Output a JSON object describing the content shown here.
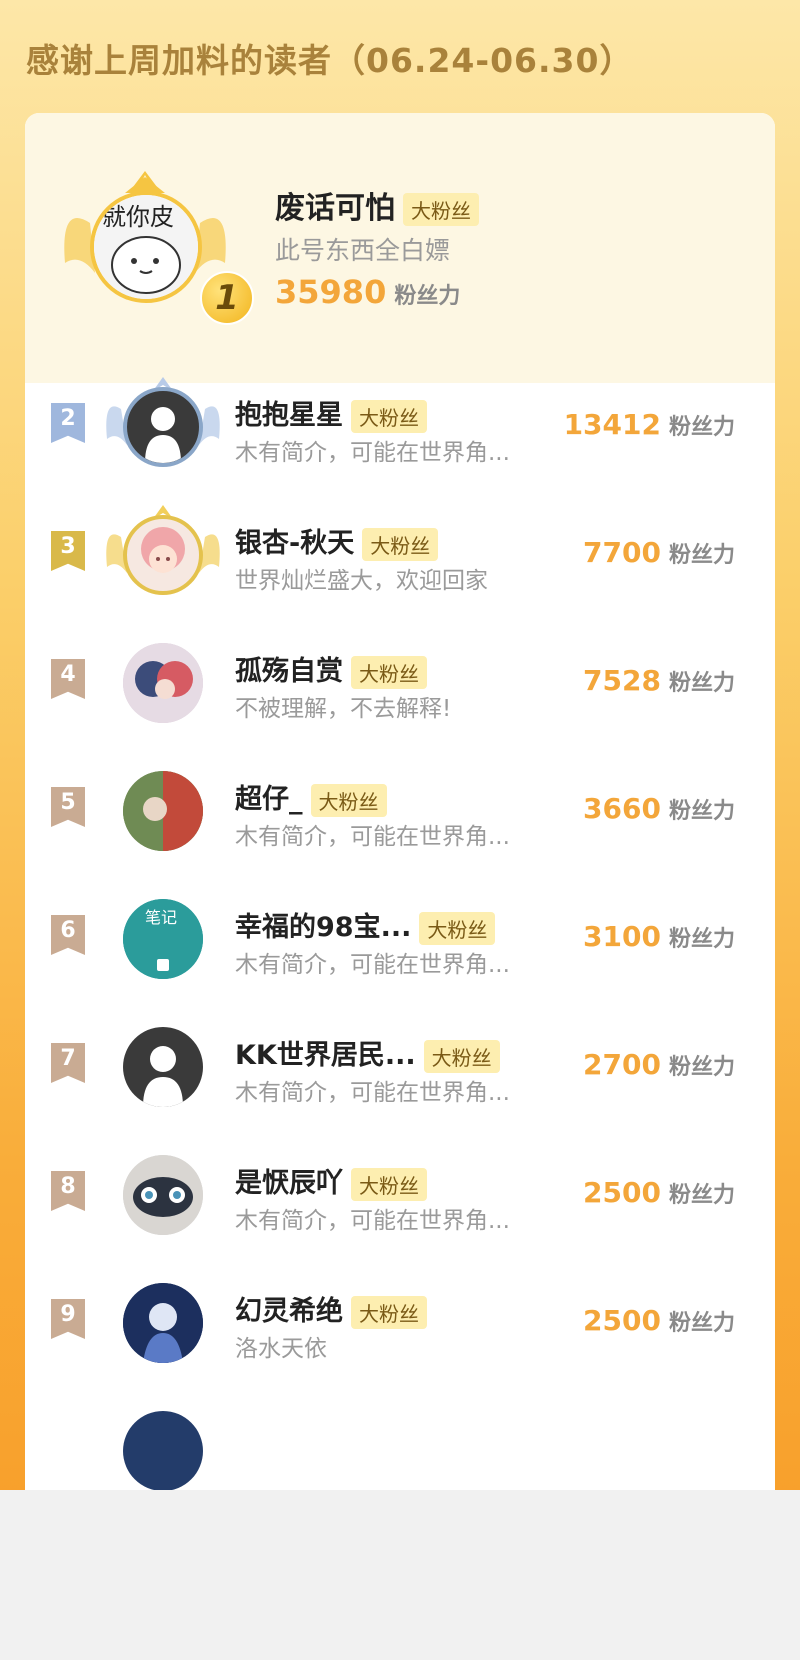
{
  "header": {
    "title": "感谢上周加料的读者（06.24-06.30）"
  },
  "top1": {
    "rank": "1",
    "name": "废话可怕",
    "tag": "大粉丝",
    "bio": "此号东西全白嫖",
    "power": "35980",
    "unit": "粉丝力",
    "avatar_text": "就你皮"
  },
  "rows": [
    {
      "rank": "2",
      "name": "抱抱星星",
      "tag": "大粉丝",
      "bio": "木有简介，可能在世界角...",
      "power": "13412",
      "unit": "粉丝力",
      "flag_color": "#9fb7dd"
    },
    {
      "rank": "3",
      "name": "银杏-秋天",
      "tag": "大粉丝",
      "bio": "世界灿烂盛大，欢迎回家",
      "power": "7700",
      "unit": "粉丝力",
      "flag_color": "#d9b94a"
    },
    {
      "rank": "4",
      "name": "孤殇自赏",
      "tag": "大粉丝",
      "bio": "不被理解，不去解释!",
      "power": "7528",
      "unit": "粉丝力",
      "flag_color": "#c9ab93"
    },
    {
      "rank": "5",
      "name": "超仔_",
      "tag": "大粉丝",
      "bio": "木有简介，可能在世界角...",
      "power": "3660",
      "unit": "粉丝力",
      "flag_color": "#c9ab93"
    },
    {
      "rank": "6",
      "name": "幸福的98宝...",
      "tag": "大粉丝",
      "bio": "木有简介，可能在世界角...",
      "power": "3100",
      "unit": "粉丝力",
      "flag_color": "#c9ab93",
      "avatar_text": "笔记"
    },
    {
      "rank": "7",
      "name": "KK世界居民...",
      "tag": "大粉丝",
      "bio": "木有简介，可能在世界角...",
      "power": "2700",
      "unit": "粉丝力",
      "flag_color": "#c9ab93"
    },
    {
      "rank": "8",
      "name": "是恹辰吖",
      "tag": "大粉丝",
      "bio": "木有简介，可能在世界角...",
      "power": "2500",
      "unit": "粉丝力",
      "flag_color": "#c9ab93"
    },
    {
      "rank": "9",
      "name": "幻灵希绝",
      "tag": "大粉丝",
      "bio": "洛水天依",
      "power": "2500",
      "unit": "粉丝力",
      "flag_color": "#c9ab93"
    }
  ],
  "colors": {
    "accent": "#f3a63a",
    "tag_bg": "#fdeeb0"
  }
}
